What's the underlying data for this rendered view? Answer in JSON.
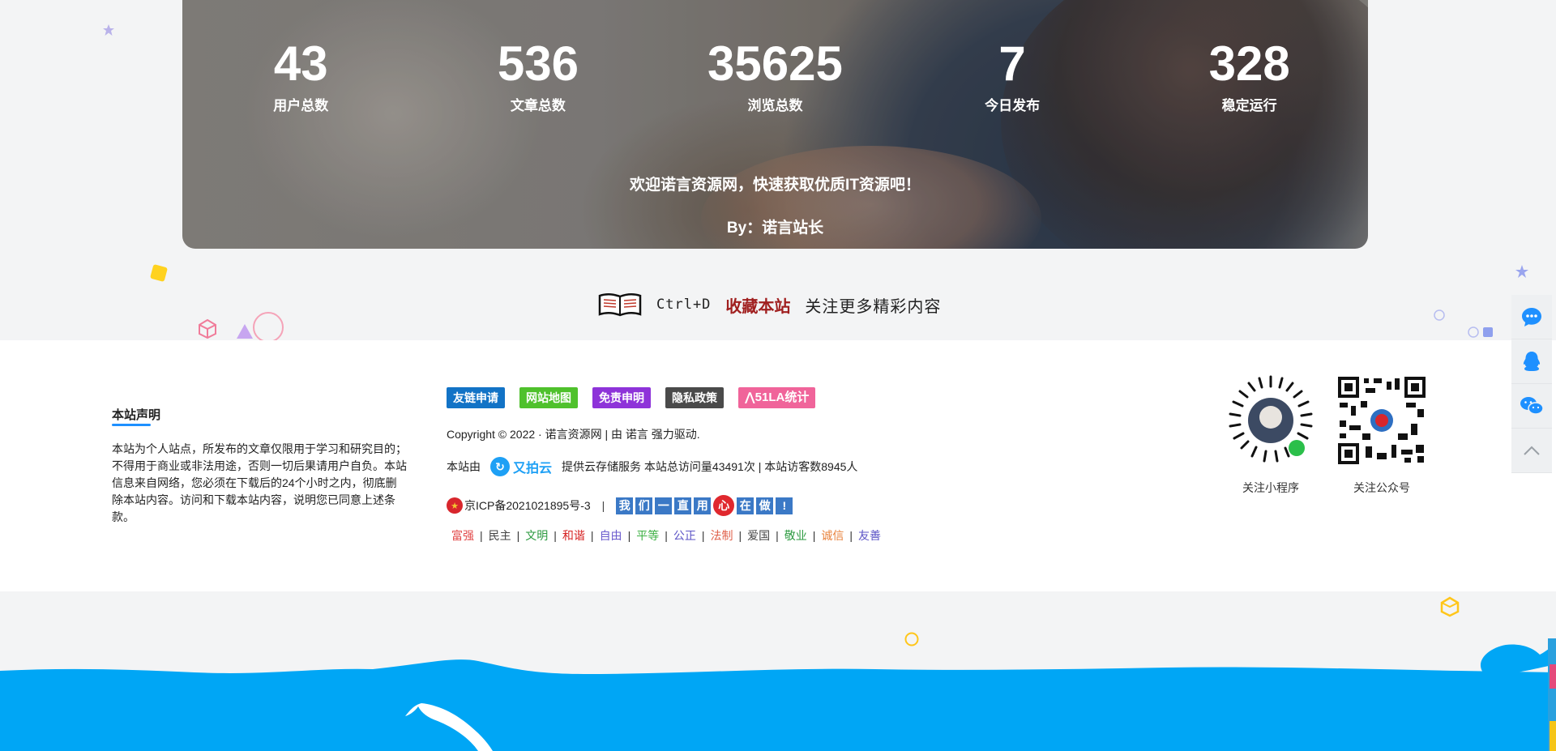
{
  "stats": [
    {
      "value": "43",
      "label": "用户总数"
    },
    {
      "value": "536",
      "label": "文章总数"
    },
    {
      "value": "35625",
      "label": "浏览总数"
    },
    {
      "value": "7",
      "label": "今日发布"
    },
    {
      "value": "328",
      "label": "稳定运行"
    }
  ],
  "banner": {
    "welcome": "欢迎诺言资源网，快速获取优质IT资源吧！",
    "author": "By：诺言站长"
  },
  "bookmark": {
    "shortcut": "Ctrl+D",
    "action": "收藏本站",
    "tip": "关注更多精彩内容"
  },
  "footer": {
    "notice_title": "本站声明",
    "notice_body": "本站为个人站点，所发布的文章仅限用于学习和研究目的；不得用于商业或非法用途，否则一切后果请用户自负。本站信息来自网络，您必须在下载后的24个小时之内，彻底删除本站内容。访问和下载本站内容，说明您已同意上述条款。",
    "links": [
      {
        "label": "友链申请",
        "color": "#1273c6"
      },
      {
        "label": "网站地图",
        "color": "#4fc12c"
      },
      {
        "label": "免责申明",
        "color": "#8e33d9"
      },
      {
        "label": "隐私政策",
        "color": "#4a4a4a"
      },
      {
        "label": "51LA统计",
        "color": "#f0649a"
      }
    ],
    "copyright": "Copyright © 2022 · 诺言资源网 |  由 诺言 强力驱动.",
    "hosting_prefix": "本站由",
    "hosting_brand": "又拍云",
    "hosting_suffix": "提供云存储服务 本站总访问量43491次 | 本站访客数8945人",
    "icp": "京ICP备2021021895号-3",
    "icp_sep": "|",
    "slogan_chars": [
      "我",
      "们",
      "一",
      "直",
      "用",
      "心",
      "在",
      "做",
      "!"
    ],
    "core_values": [
      {
        "text": "富强",
        "color": "#e24a4a"
      },
      {
        "text": "民主",
        "color": "#444444"
      },
      {
        "text": "文明",
        "color": "#2b9a3f"
      },
      {
        "text": "和谐",
        "color": "#d62222"
      },
      {
        "text": "自由",
        "color": "#6a5acd"
      },
      {
        "text": "平等",
        "color": "#3cb043"
      },
      {
        "text": "公正",
        "color": "#5b53c6"
      },
      {
        "text": "法制",
        "color": "#e0604a"
      },
      {
        "text": "爱国",
        "color": "#444444"
      },
      {
        "text": "敬业",
        "color": "#2b9a3f"
      },
      {
        "text": "诚信",
        "color": "#e8813a"
      },
      {
        "text": "友善",
        "color": "#5b53c6"
      }
    ],
    "qr_codes": [
      {
        "label": "关注小程序"
      },
      {
        "label": "关注公众号"
      }
    ]
  },
  "side_tools": [
    {
      "icon": "chat-bubble-icon"
    },
    {
      "icon": "qq-icon"
    },
    {
      "icon": "wechat-icon"
    },
    {
      "icon": "back-to-top-icon"
    }
  ],
  "colors": {
    "accent_blue": "#1e90ff",
    "wave_blue": "#00a6f5",
    "favorite_red": "#a01f1f"
  }
}
